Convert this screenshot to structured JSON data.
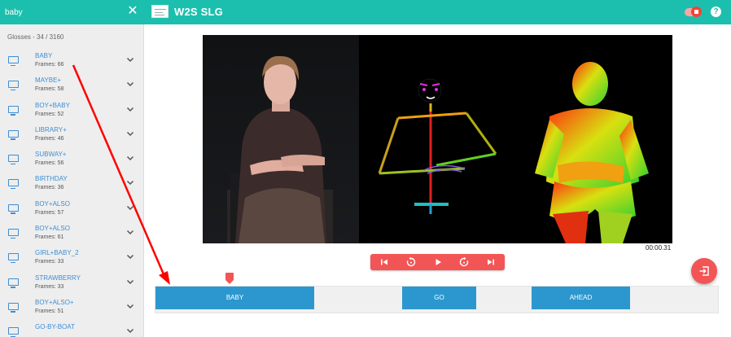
{
  "search": {
    "value": "baby",
    "clear_symbol": "✕"
  },
  "header": {
    "title": "W2S SLG",
    "help_symbol": "?"
  },
  "sidebar": {
    "count_text": "Glosses - 34 / 3160",
    "items": [
      {
        "name": "BABY",
        "frames": "Frames: 66"
      },
      {
        "name": "MAYBE+",
        "frames": "Frames: 58"
      },
      {
        "name": "BOY+BABY",
        "frames": "Frames: 52"
      },
      {
        "name": "LIBRARY+",
        "frames": "Frames: 46"
      },
      {
        "name": "SUBWAY+",
        "frames": "Frames: 56"
      },
      {
        "name": "BIRTHDAY",
        "frames": "Frames: 36"
      },
      {
        "name": "BOY+ALSO",
        "frames": "Frames: 57"
      },
      {
        "name": "BOY+ALSO",
        "frames": "Frames: 61"
      },
      {
        "name": "GIRL+BABY_2",
        "frames": "Frames: 33"
      },
      {
        "name": "STRAWBERRY",
        "frames": "Frames: 33"
      },
      {
        "name": "BOY+ALSO+",
        "frames": "Frames: 51"
      },
      {
        "name": "GO-BY-BOAT",
        "frames": ""
      }
    ]
  },
  "player": {
    "timecode": "00:00.31"
  },
  "timeline": {
    "segments": [
      {
        "label": "BABY"
      },
      {
        "label": "GO"
      },
      {
        "label": "AHEAD"
      }
    ]
  },
  "colors": {
    "accent": "#1cbfae",
    "link": "#3d8ed4",
    "control_red": "#f25555",
    "segment_blue": "#2c97cf",
    "arrow_red": "#ff0000"
  },
  "icons": {
    "search_clear": "close-icon",
    "logo": "app-logo-icon",
    "toggle": "record-toggle",
    "help": "help-circle-icon",
    "item": "tv-icon",
    "expand": "chevron-down-icon",
    "controls": [
      "skip-previous-icon",
      "replay-icon",
      "play-icon",
      "forward-icon",
      "skip-next-icon"
    ],
    "exit": "exit-icon"
  }
}
